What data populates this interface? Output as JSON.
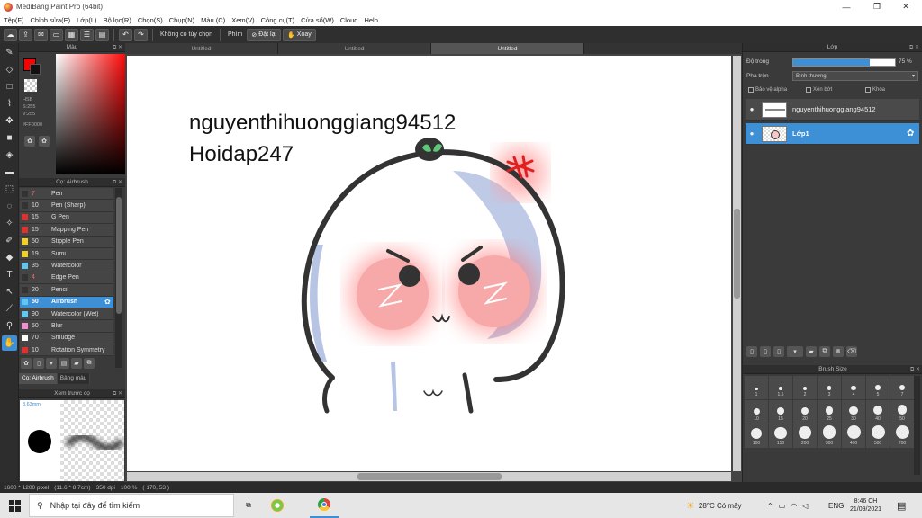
{
  "window": {
    "title": "MediBang Paint Pro (64bit)",
    "minimize": "—",
    "maximize": "❐",
    "close": "✕"
  },
  "menu": [
    "Tệp(F)",
    "Chỉnh sửa(E)",
    "Lớp(L)",
    "Bộ lọc(R)",
    "Chọn(S)",
    "Chụp(N)",
    "Màu (C)",
    "Xem(V)",
    "Công cụ(T)",
    "Cửa sổ(W)",
    "Cloud",
    "Help"
  ],
  "toolbar": {
    "no_options": "Không có tùy chọn",
    "zoom_label": "Phím",
    "reset_label": "Đặt lại",
    "rotate_label": "Xoay"
  },
  "color_panel": {
    "title": "Màu",
    "fg_color": "#ff0000",
    "mode_label": "HSB",
    "s_value": "S:255",
    "v_value": "V:255",
    "hex_value": "#FF0000"
  },
  "brush_panel": {
    "title": "Cọ: Airbrush",
    "brushes": [
      {
        "size": "7",
        "name": "Pen",
        "color": "#333333",
        "size_color": "#ff6666"
      },
      {
        "size": "10",
        "name": "Pen (Sharp)",
        "color": "#333333",
        "size_color": "#dddddd"
      },
      {
        "size": "15",
        "name": "G Pen",
        "color": "#e03030",
        "size_color": "#dddddd"
      },
      {
        "size": "15",
        "name": "Mapping Pen",
        "color": "#e03030",
        "size_color": "#dddddd"
      },
      {
        "size": "50",
        "name": "Stipple Pen",
        "color": "#f0d020",
        "size_color": "#dddddd"
      },
      {
        "size": "19",
        "name": "Sumi",
        "color": "#f0d020",
        "size_color": "#dddddd"
      },
      {
        "size": "35",
        "name": "Watercolor",
        "color": "#60c8f0",
        "size_color": "#dddddd"
      },
      {
        "size": "4",
        "name": "Edge Pen",
        "color": "#333333",
        "size_color": "#ff6666"
      },
      {
        "size": "20",
        "name": "Pencil",
        "color": "#333333",
        "size_color": "#dddddd"
      },
      {
        "size": "50",
        "name": "Airbrush",
        "color": "#60c8f0",
        "size_color": "#ff6666",
        "active": true
      },
      {
        "size": "90",
        "name": "Watercolor (Wet)",
        "color": "#60c8f0",
        "size_color": "#dddddd"
      },
      {
        "size": "50",
        "name": "Blur",
        "color": "#f090d0",
        "size_color": "#dddddd"
      },
      {
        "size": "70",
        "name": "Smudge",
        "color": "#ffffff",
        "size_color": "#dddddd"
      },
      {
        "size": "10",
        "name": "Rotation Symmetry",
        "color": "#e03030",
        "size_color": "#dddddd"
      }
    ],
    "tab_brush": "Cọ: Airbrush",
    "tab_colors": "Bảng màu"
  },
  "preview_panel": {
    "title": "Xem trước cọ",
    "size_text": "3.63mm"
  },
  "documents": {
    "tabs": [
      "Untitled",
      "Untitled",
      "Untitled"
    ]
  },
  "canvas": {
    "text_line1": "nguyenthihuonggiang94512",
    "text_line2": "Hoidap247"
  },
  "layer_panel": {
    "title": "Lớp",
    "opacity_label": "Độ trong",
    "opacity_value": "75 %",
    "opacity_fraction": 0.75,
    "blend_label": "Pha trộn",
    "blend_value": "Bình thường",
    "protect_alpha": "Bảo vệ alpha",
    "clipping": "Xén bớt",
    "lock": "Khóa",
    "layers": [
      {
        "name": "nguyenthihuonggiang94512",
        "active": false
      },
      {
        "name": "Lớp1",
        "active": true
      }
    ]
  },
  "brush_size_panel": {
    "title": "Brush Size",
    "sizes": [
      "1",
      "1.5",
      "2",
      "3",
      "4",
      "5",
      "7",
      "10",
      "15",
      "20",
      "25",
      "30",
      "40",
      "50",
      "100",
      "150",
      "200",
      "300",
      "400",
      "500",
      "700"
    ]
  },
  "status": {
    "dimensions": "1600 * 1200 pixel",
    "physical": "(11.6 * 8.7cm)",
    "dpi": "350 dpi",
    "zoom": "100 %",
    "coords": "( 170, 53 )"
  },
  "taskbar": {
    "search_placeholder": "Nhập tại đây để tìm kiếm",
    "weather": "28°C  Có mây",
    "lang": "ENG",
    "time": "8:46 CH",
    "date": "21/09/2021"
  }
}
